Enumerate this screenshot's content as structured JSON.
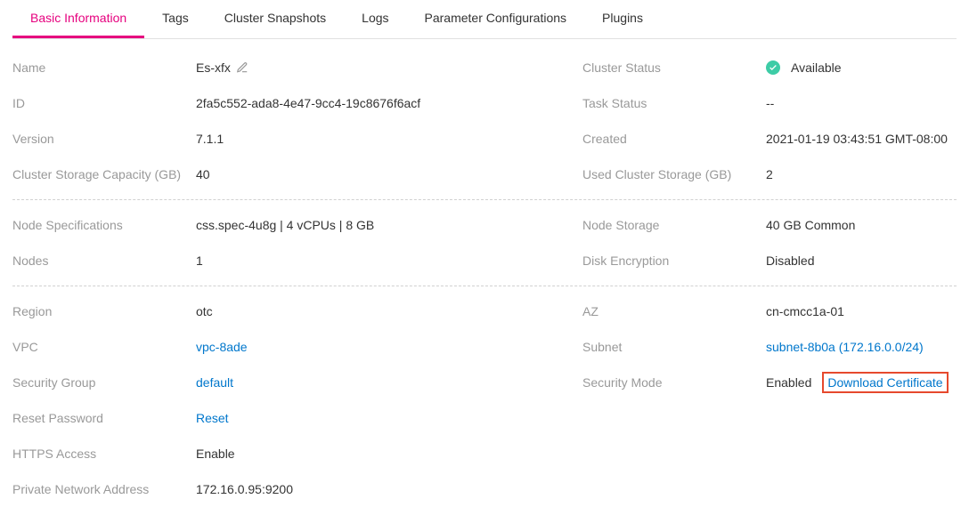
{
  "tabs": {
    "basic_information": "Basic Information",
    "tags": "Tags",
    "cluster_snapshots": "Cluster Snapshots",
    "logs": "Logs",
    "parameter_configurations": "Parameter Configurations",
    "plugins": "Plugins"
  },
  "section1": {
    "left": {
      "name": {
        "label": "Name",
        "value": "Es-xfx"
      },
      "id": {
        "label": "ID",
        "value": "2fa5c552-ada8-4e47-9cc4-19c8676f6acf"
      },
      "version": {
        "label": "Version",
        "value": "7.1.1"
      },
      "storage_capacity": {
        "label": "Cluster Storage Capacity (GB)",
        "value": "40"
      }
    },
    "right": {
      "cluster_status": {
        "label": "Cluster Status",
        "value": "Available"
      },
      "task_status": {
        "label": "Task Status",
        "value": "--"
      },
      "created": {
        "label": "Created",
        "value": "2021-01-19 03:43:51 GMT-08:00"
      },
      "used_storage": {
        "label": "Used Cluster Storage (GB)",
        "value": "2"
      }
    }
  },
  "section2": {
    "left": {
      "node_spec": {
        "label": "Node Specifications",
        "value": "css.spec-4u8g | 4 vCPUs | 8 GB"
      },
      "nodes": {
        "label": "Nodes",
        "value": "1"
      }
    },
    "right": {
      "node_storage": {
        "label": "Node Storage",
        "value": "40 GB Common"
      },
      "disk_encryption": {
        "label": "Disk Encryption",
        "value": "Disabled"
      }
    }
  },
  "section3": {
    "left": {
      "region": {
        "label": "Region",
        "value": "otc"
      },
      "vpc": {
        "label": "VPC",
        "value": "vpc-8ade"
      },
      "security_group": {
        "label": "Security Group",
        "value": "default"
      },
      "reset_password": {
        "label": "Reset Password",
        "value": "Reset"
      },
      "https_access": {
        "label": "HTTPS Access",
        "value": "Enable"
      },
      "private_network": {
        "label": "Private Network Address",
        "value": "172.16.0.95:9200"
      }
    },
    "right": {
      "az": {
        "label": "AZ",
        "value": "cn-cmcc1a-01"
      },
      "subnet": {
        "label": "Subnet",
        "value": "subnet-8b0a (172.16.0.0/24)"
      },
      "security_mode": {
        "label": "Security Mode",
        "value": "Enabled",
        "action": "Download Certificate"
      }
    }
  }
}
